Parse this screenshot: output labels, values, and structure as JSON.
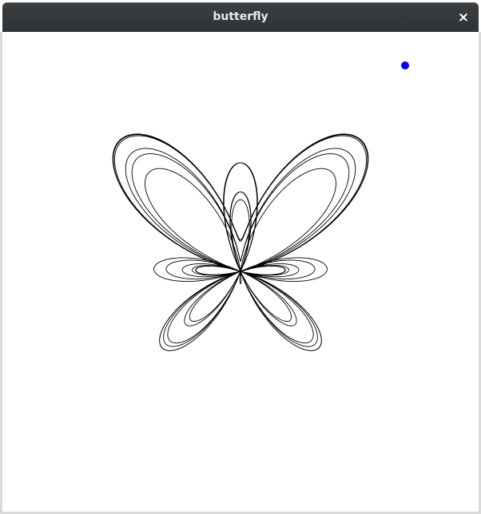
{
  "window": {
    "title": "butterfly",
    "close_label": "×"
  },
  "canvas": {
    "curve_color": "#000000",
    "marker_color": "#0000ff",
    "background": "#ffffff"
  }
}
